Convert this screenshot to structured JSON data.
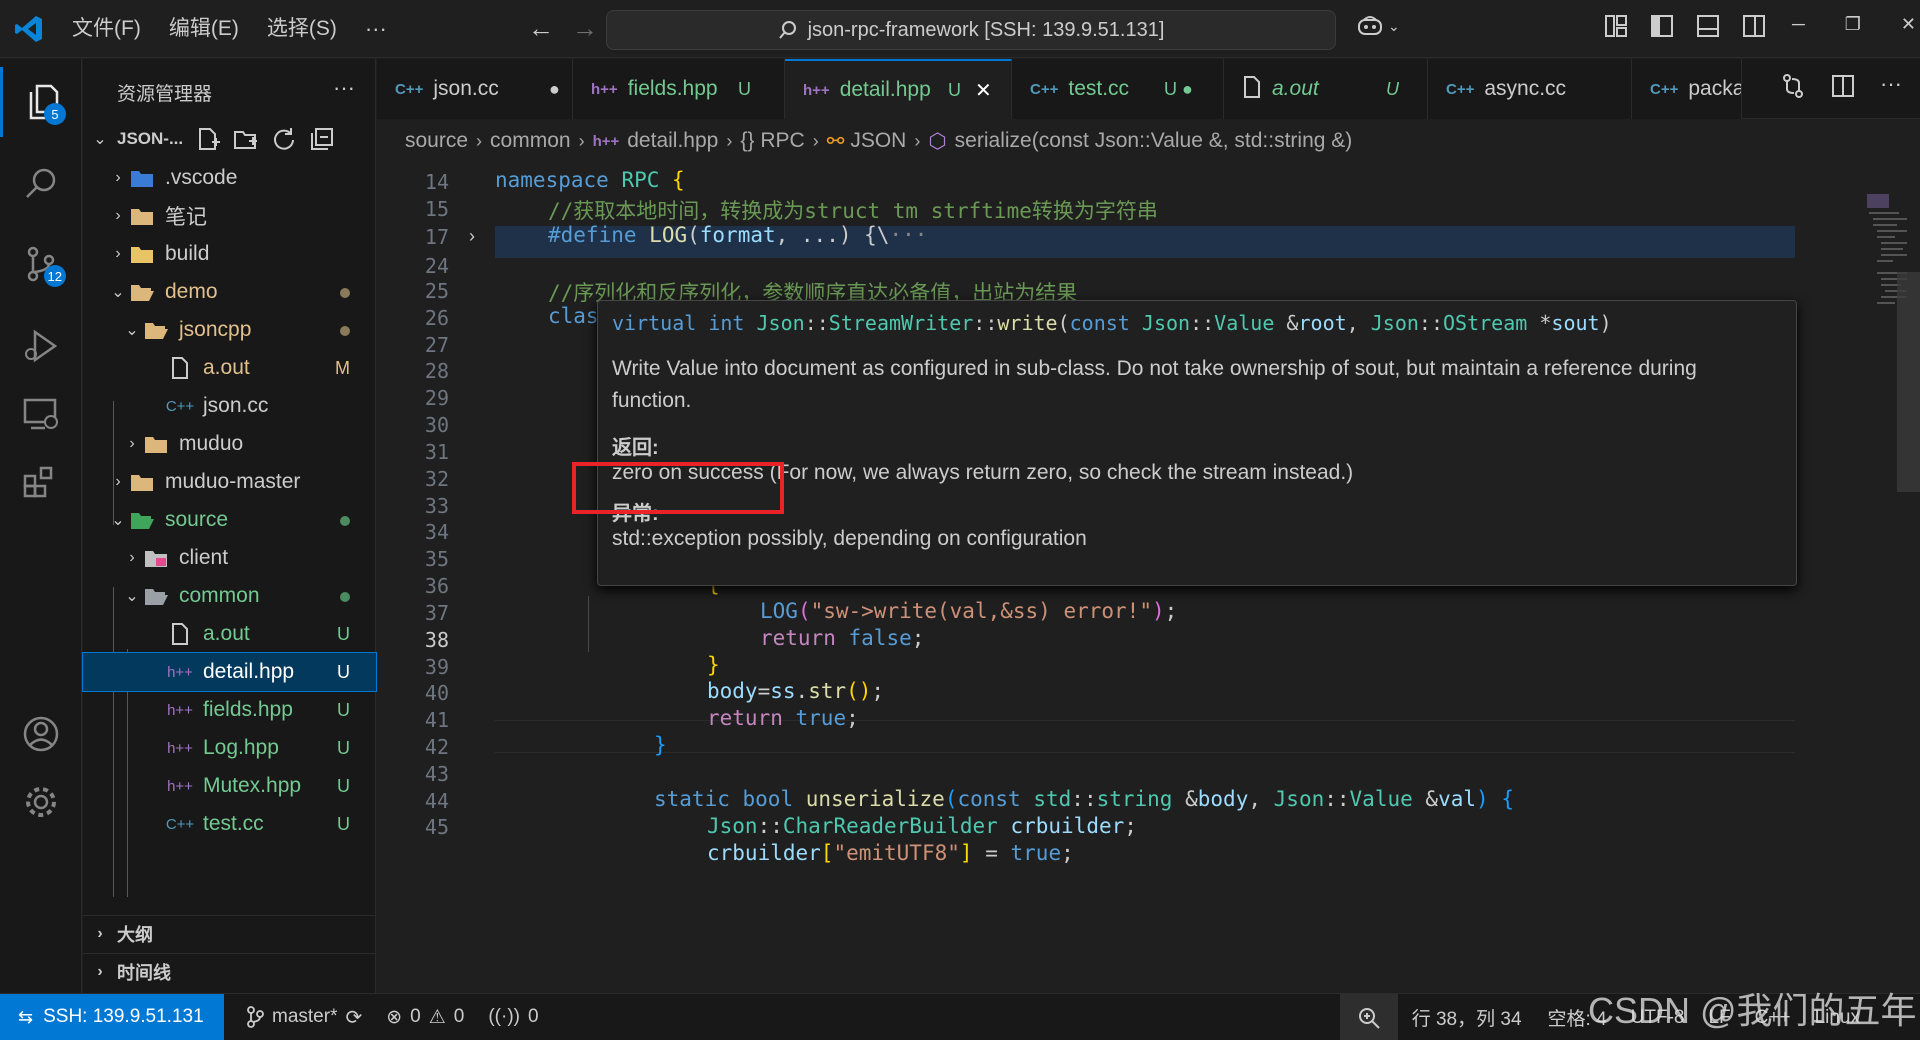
{
  "titlebar": {
    "menus": [
      "文件(F)",
      "编辑(E)",
      "选择(S)"
    ],
    "more": "···",
    "command_center": "json-rpc-framework [SSH: 139.9.51.131]"
  },
  "activity": {
    "explorer_badge": "5",
    "scm_badge": "12"
  },
  "sidebar": {
    "title": "资源管理器",
    "more": "···",
    "folder": "JSON-...",
    "tree": [
      {
        "label": ".vscode",
        "status": ""
      },
      {
        "label": "笔记",
        "status": ""
      },
      {
        "label": "build",
        "status": ""
      },
      {
        "label": "demo",
        "status": ""
      },
      {
        "label": "jsoncpp",
        "status": ""
      },
      {
        "label": "a.out",
        "status": "M"
      },
      {
        "label": "json.cc",
        "status": ""
      },
      {
        "label": "muduo",
        "status": ""
      },
      {
        "label": "muduo-master",
        "status": ""
      },
      {
        "label": "source",
        "status": ""
      },
      {
        "label": "client",
        "status": ""
      },
      {
        "label": "common",
        "status": ""
      },
      {
        "label": "a.out",
        "status": "U"
      },
      {
        "label": "detail.hpp",
        "status": "U"
      },
      {
        "label": "fields.hpp",
        "status": "U"
      },
      {
        "label": "Log.hpp",
        "status": "U"
      },
      {
        "label": "Mutex.hpp",
        "status": "U"
      },
      {
        "label": "test.cc",
        "status": "U"
      }
    ],
    "outline": "大纲",
    "timeline": "时间线"
  },
  "tabs": [
    {
      "label": "json.cc",
      "status": "●"
    },
    {
      "label": "fields.hpp",
      "status": "U"
    },
    {
      "label": "detail.hpp",
      "status": "U"
    },
    {
      "label": "test.cc",
      "status": "U ●"
    },
    {
      "label": "a.out",
      "status": "U"
    },
    {
      "label": "async.cc",
      "status": ""
    },
    {
      "label": "packa",
      "status": ""
    }
  ],
  "active_tab_close": "✕",
  "breadcrumb": [
    "source",
    "common",
    "detail.hpp",
    "RPC",
    "JSON",
    "serialize(const Json::Value &, std::string &)"
  ],
  "line_numbers": [
    "14",
    "15",
    "17",
    "24",
    "25",
    "26",
    "27",
    "28",
    "29",
    "30",
    "31",
    "32",
    "33",
    "34",
    "35",
    "36",
    "37",
    "38",
    "39",
    "40",
    "41",
    "42",
    "43",
    "44",
    "45"
  ],
  "hover": {
    "signature": {
      "kw1": "virtual",
      "kw2": "int",
      "cls": "Json",
      "sep": "::",
      "cls2": "StreamWriter",
      "sep2": "::",
      "fn": "write",
      "open": "(",
      "kw3": "const",
      "cls3": "Json",
      "sep3": "::",
      "cls4": "Value",
      "amp": " &",
      "p1": "root",
      "comma": ", ",
      "cls5": "Json",
      "sep4": "::",
      "cls6": "OStream",
      "star": " *",
      "p2": "sout",
      "close": ")"
    },
    "description": "Write Value into document as configured in sub-class. Do not take ownership of sout, but maintain a reference during function.",
    "returns_heading": "返回:",
    "returns_highlight": "zero on success",
    "returns_rest": " (For now, we always return zero, so check the stream instead.)",
    "throws_heading": "异常:",
    "throws_text": "std::exception possibly, depending on configuration"
  },
  "status": {
    "remote": "SSH: 139.9.51.131",
    "branch": "master*",
    "errors": "0",
    "warnings": "0",
    "ports": "0",
    "position": "行 38，列 34",
    "spaces": "空格: 4",
    "encoding": "UTF-8",
    "eol": "LF",
    "language": "C++",
    "platform": "Linux"
  },
  "watermark": "CSDN @我们的五年",
  "colors": {
    "accent": "#0078d4",
    "modified": "#e2c08d",
    "untracked": "#73c991",
    "highlight_box": "#e8232a"
  }
}
